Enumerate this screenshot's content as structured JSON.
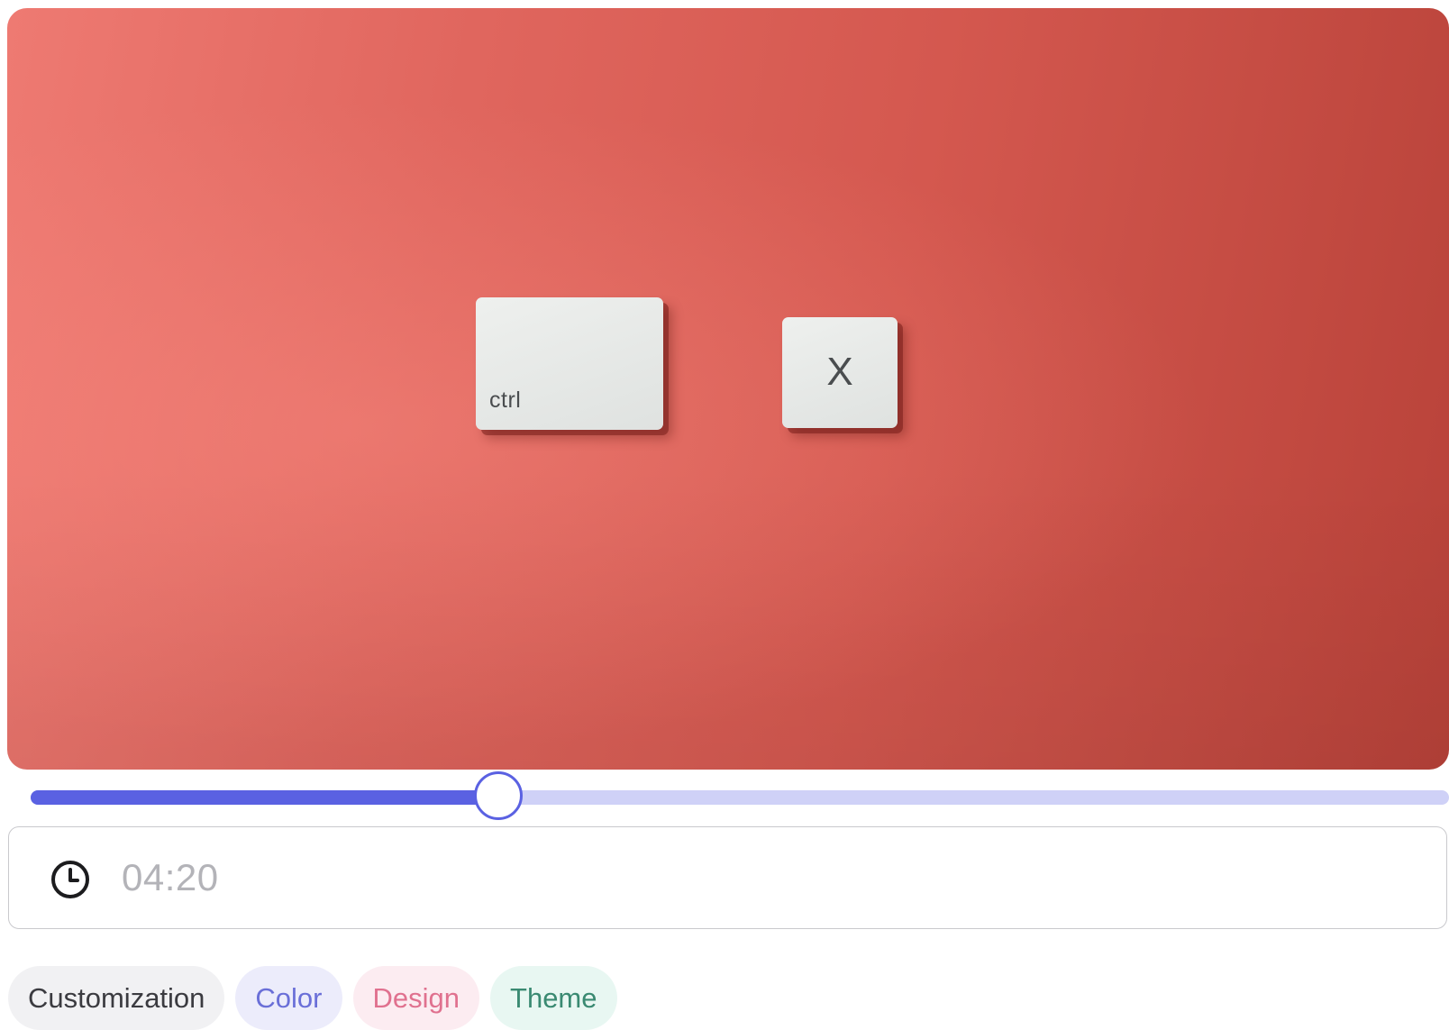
{
  "hero": {
    "keys": [
      {
        "label": "ctrl"
      },
      {
        "label": "X"
      }
    ]
  },
  "slider": {
    "value_fraction": 0.33
  },
  "time_input": {
    "icon": "clock-icon",
    "value": "04:20"
  },
  "tags": [
    {
      "label": "Customization",
      "style": "gray"
    },
    {
      "label": "Color",
      "style": "indigo"
    },
    {
      "label": "Design",
      "style": "pink"
    },
    {
      "label": "Theme",
      "style": "teal"
    }
  ],
  "colors": {
    "accent": "#5a61e2",
    "track": "#cfd1f7",
    "hero_background": "#e0665e"
  }
}
